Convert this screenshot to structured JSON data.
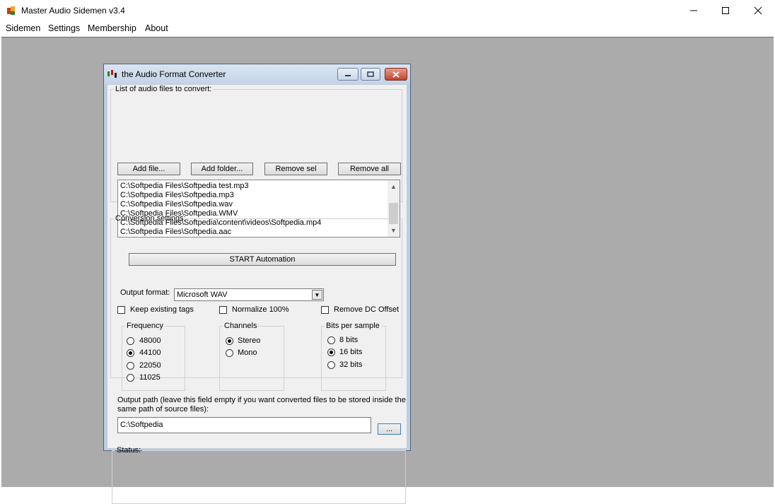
{
  "window": {
    "title": "Master Audio Sidemen v3.4",
    "minimize": "─",
    "maximize": "☐",
    "close": "✕"
  },
  "menu": [
    "Sidemen",
    "Settings",
    "Membership",
    "About"
  ],
  "dialog": {
    "title": "the Audio Format Converter",
    "files_group": {
      "legend": "List of audio files to convert:",
      "add_file": "Add file...",
      "add_folder": "Add folder...",
      "remove_sel": "Remove sel",
      "remove_all": "Remove all",
      "files": [
        "C:\\Softpedia Files\\Softpedia test.mp3",
        "C:\\Softpedia Files\\Softpedia.mp3",
        "C:\\Softpedia Files\\Softpedia.wav",
        "C:\\Softpedia Files\\Softpedia.WMV",
        "C:\\Softpedia Files\\Softpedia\\content\\videos\\Softpedia.mp4",
        "C:\\Softpedia Files\\Softpedia.aac"
      ],
      "start": "START Automation"
    },
    "conversion": {
      "legend": "Conversion settings:",
      "output_format_label": "Output format:",
      "output_format_value": "Microsoft WAV",
      "keep_tags": "Keep existing tags",
      "normalize": "Normalize 100%",
      "remove_dc": "Remove DC Offset",
      "frequency": {
        "legend": "Frequency",
        "options": [
          "48000",
          "44100",
          "22050",
          "11025"
        ],
        "selected": "44100"
      },
      "channels": {
        "legend": "Channels",
        "options": [
          "Stereo",
          "Mono"
        ],
        "selected": "Stereo"
      },
      "bits": {
        "legend": "Bits per sample",
        "options": [
          "8 bits",
          "16 bits",
          "32 bits"
        ],
        "selected": "16 bits"
      },
      "output_path_label_1": "Output path (leave this field empty if you want converted files to be stored inside the",
      "output_path_label_2": "same path of source files):",
      "output_path_value": "C:\\Softpedia",
      "browse": "..."
    },
    "status": {
      "legend": "Status:"
    }
  }
}
